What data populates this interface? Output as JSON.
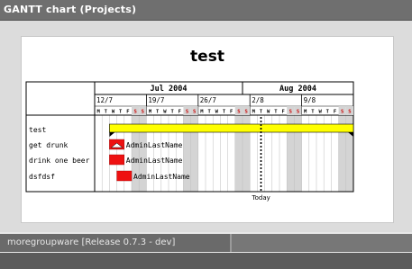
{
  "window": {
    "title": "GANTT chart (Projects)"
  },
  "chart_data": {
    "type": "gantt",
    "title": "test",
    "months": [
      "Jul 2004",
      "Aug 2004"
    ],
    "weeks": [
      "12/7",
      "19/7",
      "26/7",
      "2/8",
      "9/8"
    ],
    "weekday_letters": [
      "M",
      "T",
      "W",
      "T",
      "F",
      "S",
      "S"
    ],
    "today_label": "Today",
    "rows": [
      {
        "name": "test",
        "type": "project",
        "start": "2004-07-14",
        "end": "2004-08-15"
      },
      {
        "name": "get drunk",
        "type": "task",
        "start": "2004-07-14",
        "end": "2004-07-15",
        "assignee": "AdminLastName",
        "today_marker": true
      },
      {
        "name": "drink one beer",
        "type": "task",
        "start": "2004-07-14",
        "end": "2004-07-15",
        "assignee": "AdminLastName"
      },
      {
        "name": "dsfdsf",
        "type": "task",
        "start": "2004-07-15",
        "end": "2004-07-16",
        "assignee": "AdminLastName"
      }
    ],
    "colors": {
      "project": "#ffff00",
      "task": "#ee1111",
      "weekend_shade": "#d4d4d4",
      "weekend_text": "#cc0000"
    }
  },
  "footer": {
    "text": "moregroupware [Release 0.7.3 - dev]"
  }
}
